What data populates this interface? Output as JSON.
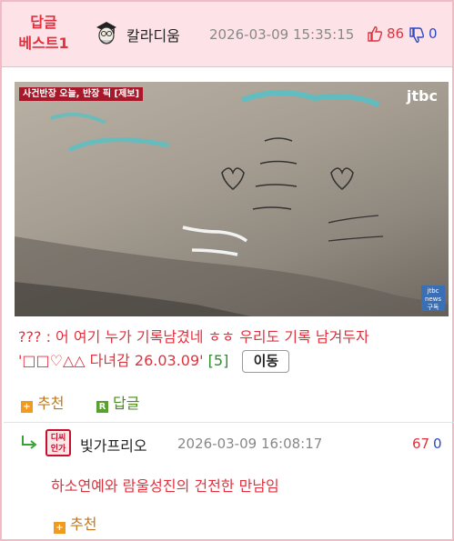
{
  "best": {
    "line1": "답글",
    "line2": "베스트1"
  },
  "post": {
    "author": "칼라디움",
    "datetime": "2026-03-09 15:35:15",
    "upvotes": "86",
    "downvotes": "0"
  },
  "image": {
    "caption_tag": "사건반장 오늘, 반장 픽 [제보]",
    "logo": "jtbc",
    "badge_line1": "jtbc",
    "badge_line2": "news",
    "badge_line3": "구독"
  },
  "comment": {
    "text_line1": "??? : 어 여기 누가 기록남겼네 ㅎㅎ 우리도 기록 남겨두자",
    "text_line2": "'□□♡△△ 다녀감 26.03.09'",
    "reply_count": "[5]",
    "move_button": "이동"
  },
  "actions": {
    "recommend": "추천",
    "reply": "답글"
  },
  "reply": {
    "author": "빛가프리오",
    "avatar_text": "디씨인가",
    "datetime": "2026-03-09 16:08:17",
    "upvotes": "67",
    "downvotes": "0",
    "text": "하소연예와 람울성진의 건전한 만남임",
    "recommend": "추천"
  },
  "colors": {
    "accent": "#e0323e",
    "header_bg": "#fde3e8",
    "border": "#f3b9c5",
    "down": "#2b48c8"
  }
}
